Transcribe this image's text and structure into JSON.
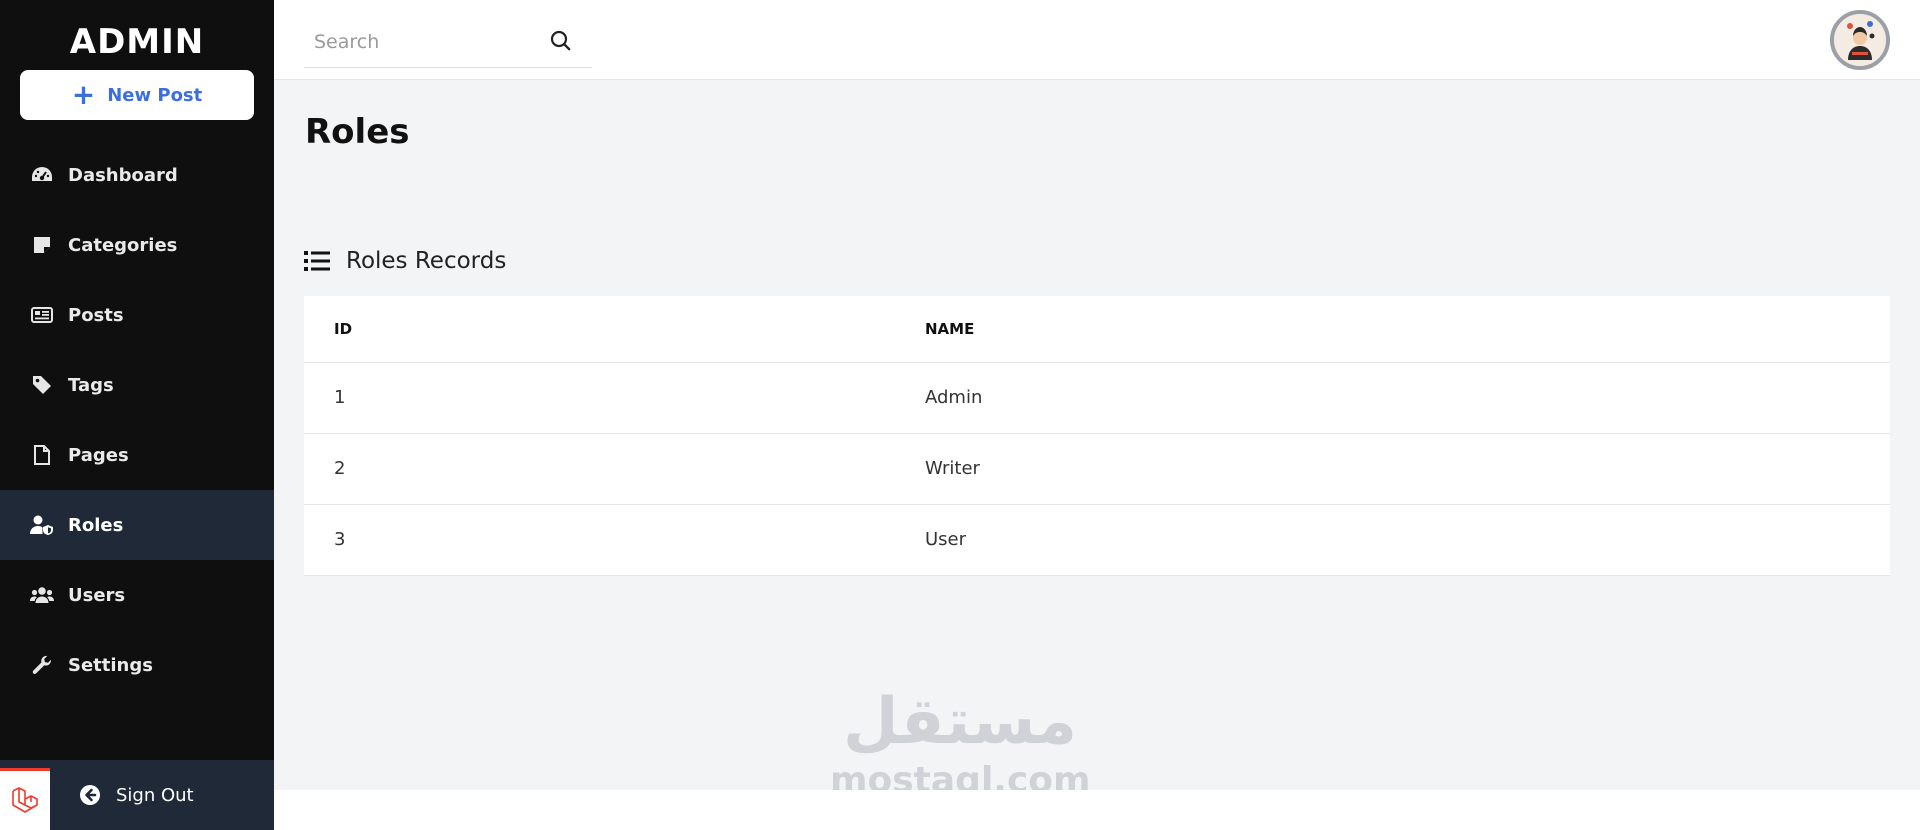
{
  "sidebar": {
    "brand": "ADMIN",
    "new_post_label": "New Post",
    "items": [
      {
        "label": "Dashboard",
        "icon": "dashboard-icon"
      },
      {
        "label": "Categories",
        "icon": "sticky-note-icon"
      },
      {
        "label": "Posts",
        "icon": "newspaper-icon"
      },
      {
        "label": "Tags",
        "icon": "tag-icon"
      },
      {
        "label": "Pages",
        "icon": "file-icon"
      },
      {
        "label": "Roles",
        "icon": "user-shield-icon",
        "active": true
      },
      {
        "label": "Users",
        "icon": "users-icon"
      },
      {
        "label": "Settings",
        "icon": "wrench-icon"
      }
    ],
    "sign_out_label": "Sign Out"
  },
  "topbar": {
    "search_placeholder": "Search"
  },
  "main": {
    "page_title": "Roles",
    "section_title": "Roles Records",
    "table": {
      "columns": [
        "ID",
        "NAME"
      ],
      "rows": [
        {
          "id": "1",
          "name": "Admin"
        },
        {
          "id": "2",
          "name": "Writer"
        },
        {
          "id": "3",
          "name": "User"
        }
      ]
    }
  },
  "watermark": {
    "arabic": "مستقل",
    "latin": "mostaql.com"
  },
  "colors": {
    "sidebar_bg": "#0f0f10",
    "sidebar_active": "#1f2937",
    "accent": "#3b6fe0",
    "content_bg": "#f3f4f6"
  }
}
